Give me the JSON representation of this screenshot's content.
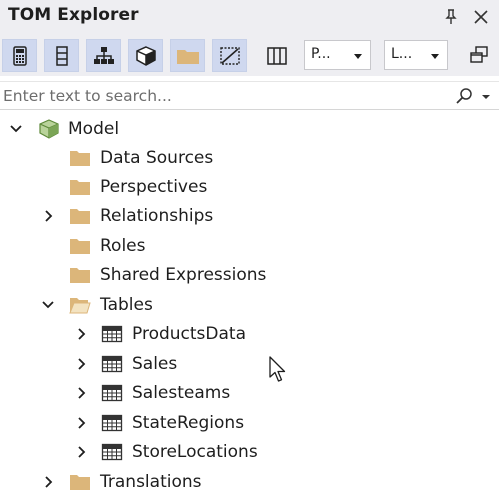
{
  "window": {
    "title": "TOM Explorer"
  },
  "toolbar": {
    "combo_perspective": "P...",
    "combo_language": "L..."
  },
  "search": {
    "placeholder": "Enter text to search..."
  },
  "tree": {
    "model": "Model",
    "data_sources": "Data Sources",
    "perspectives": "Perspectives",
    "relationships": "Relationships",
    "roles": "Roles",
    "shared_expressions": "Shared Expressions",
    "tables": "Tables",
    "table_items": [
      "ProductsData",
      "Sales",
      "Salesteams",
      "StateRegions",
      "StoreLocations"
    ],
    "translations": "Translations"
  },
  "colors": {
    "folder": "#dcb67a",
    "toolbar_active": "#cfd8ef",
    "background": "#ffffff",
    "chrome": "#eeeef2"
  }
}
